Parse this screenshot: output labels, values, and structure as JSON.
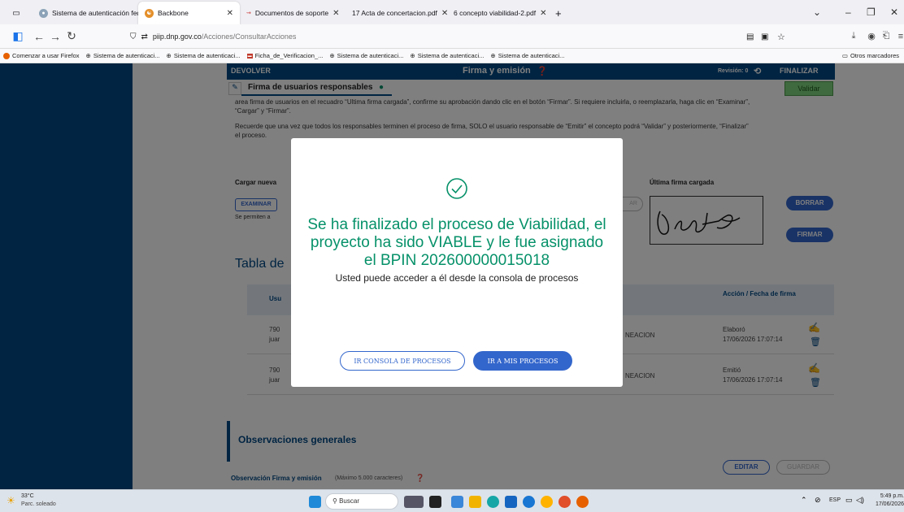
{
  "browser": {
    "tabs": [
      {
        "title": "Sistema de autenticación federada",
        "active": false
      },
      {
        "title": "Backbone",
        "active": true
      },
      {
        "title": "Documentos de soporte",
        "active": false
      },
      {
        "title": "17 Acta de concertacion.pdf",
        "active": false
      },
      {
        "title": "6 concepto viabilidad-2.pdf",
        "active": false
      }
    ],
    "new_tab": "+",
    "url_domain": "piip.dnp.gov.co",
    "url_path": "/Acciones/ConsultarAcciones",
    "bookmarks": [
      "Comenzar a usar Firefox",
      "Sistema de autenticaci...",
      "Sistema de autenticaci...",
      "Ficha_de_Verificacion_...",
      "Sistema de autenticaci...",
      "Sistema de autenticaci...",
      "Sistema de autenticaci..."
    ],
    "other_bookmarks": "Otros marcadores"
  },
  "header": {
    "back_label": "DEVOLVER",
    "title": "Firma y emisión",
    "revision_label": "Revisión: 0",
    "finalize_label": "FINALIZAR",
    "section_title": "Firma de usuarios responsables",
    "validate_label": "Validar"
  },
  "body": {
    "instructions_1a": "area firma de usuarios en el recuadro “Ultima firma cargada”, confirme su aprobación dando clic en el botón “Firmar”. Si requiere incluirla, o reemplazarla, haga clic en “Examinar”,",
    "instructions_1b": "“Cargar” y “Firmar”.",
    "instructions_2a": "Recuerde que una vez que todos los responsables terminen el proceso de firma, SOLO el usuario responsable de “Emitir” el concepto podrá “Validar” y posteriormente, “Finalizar”",
    "instructions_2b": "el proceso.",
    "upload_label": "Cargar nueva",
    "browse_label": "EXAMINAR",
    "allowed_label": "Se permiten a",
    "upload_ghost": "AR",
    "last_signature_label": "Última firma cargada",
    "delete_label": "BORRAR",
    "sign_label": "FIRMAR",
    "table_title": "Tabla de",
    "table_header_user": "Usu",
    "table_header_action": "Acción / Fecha de firma",
    "rows": [
      {
        "id": "790",
        "name": "juar",
        "entity": "NEACION",
        "action": "Elaboró",
        "date": "17/06/2026 17:07:14"
      },
      {
        "id": "790",
        "name": "juar",
        "entity": "NEACION",
        "action": "Emitió",
        "date": "17/06/2026 17:07:14"
      }
    ],
    "observations_title": "Observaciones generales",
    "observations_label": "Observación Firma y emisión",
    "observations_hint": "(Máximo 5.000 caracteres)",
    "edit_label": "EDITAR",
    "save_label": "GUARDAR"
  },
  "modal": {
    "message": "Se ha finalizado el proceso de Viabilidad, el proyecto ha sido VIABLE y le fue asignado el BPIN 202600000015018",
    "sub_message": "Usted puede acceder a él desde la consola de procesos",
    "console_button": "IR CONSOLA DE PROCESOS",
    "my_processes_button": "IR A MIS PROCESOS"
  },
  "taskbar": {
    "temperature": "33°C",
    "weather": "Parc. soleado",
    "search_placeholder": "Buscar",
    "lang": "ESP",
    "time": "5:49 p.m.",
    "date": "17/06/2026"
  },
  "colors": {
    "primary_blue": "#004884",
    "success_green": "#069169",
    "button_blue": "#3366cc",
    "validate_green": "#7ed37e"
  }
}
